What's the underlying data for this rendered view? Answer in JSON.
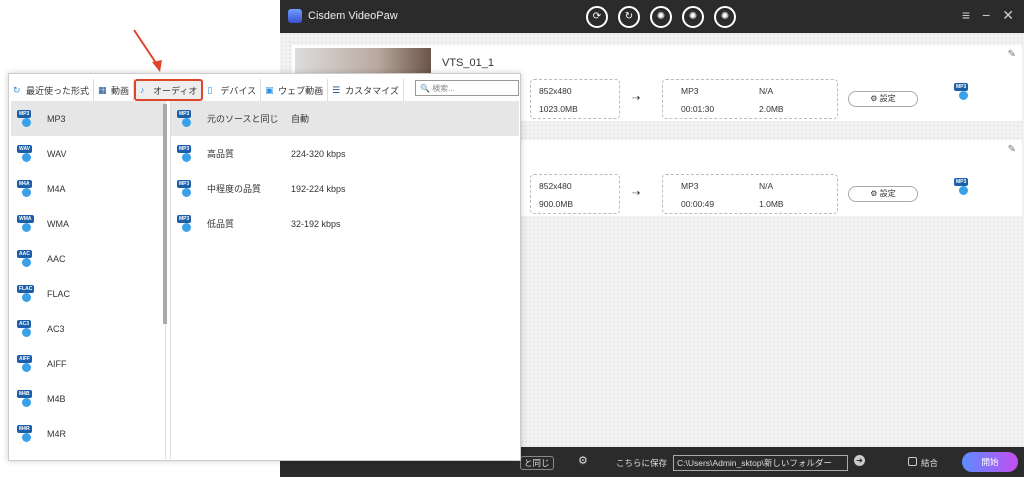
{
  "app": {
    "title": "Cisdem VideoPaw",
    "mode_icons": [
      "convert-icon",
      "download-icon",
      "film-icon",
      "film-edit-icon",
      "film-compress-icon"
    ],
    "window_controls": [
      "≡",
      "−",
      "✕"
    ]
  },
  "files": [
    {
      "name": "VTS_01_1",
      "src_resolution": "852x480",
      "src_size": "1023.0MB",
      "out_format": "MP3",
      "out_resolution": "N/A",
      "out_duration": "00:01:30",
      "out_size": "2.0MB",
      "settings": "⚙ 設定",
      "badge": "MP3"
    },
    {
      "name": "",
      "src_resolution": "852x480",
      "src_size": "900.0MB",
      "out_format": "MP3",
      "out_resolution": "N/A",
      "out_duration": "00:00:49",
      "out_size": "1.0MB",
      "settings": "⚙ 設定",
      "badge": "MP3"
    }
  ],
  "bottom": {
    "quality_select": "と同じ",
    "save_to_label": "こちらに保存",
    "path": "C:\\Users\\Admin_sktop\\新しいフォルダー",
    "merge_label": "結合",
    "start_label": "開始"
  },
  "panel": {
    "tabs": [
      {
        "label": "最近使った形式",
        "icon": "↻"
      },
      {
        "label": "動画",
        "icon": "▦"
      },
      {
        "label": "オーディオ",
        "icon": "♪"
      },
      {
        "label": "デバイス",
        "icon": "▯"
      },
      {
        "label": "ウェブ動画",
        "icon": "▣"
      },
      {
        "label": "カスタマイズ",
        "icon": "☰"
      }
    ],
    "search_placeholder": "検索...",
    "formats": [
      "MP3",
      "WAV",
      "M4A",
      "WMA",
      "AAC",
      "FLAC",
      "AC3",
      "AIFF",
      "M4B",
      "M4R"
    ],
    "qualities": [
      {
        "name": "元のソースと同じ",
        "value": "自動"
      },
      {
        "name": "高品質",
        "value": "224-320 kbps"
      },
      {
        "name": "中程度の品質",
        "value": "192-224 kbps"
      },
      {
        "name": "低品質",
        "value": "32-192 kbps"
      }
    ]
  },
  "colors": {
    "accent": "#e0452a",
    "start_gradient": [
      "#5b8cff",
      "#c44ef0"
    ]
  }
}
